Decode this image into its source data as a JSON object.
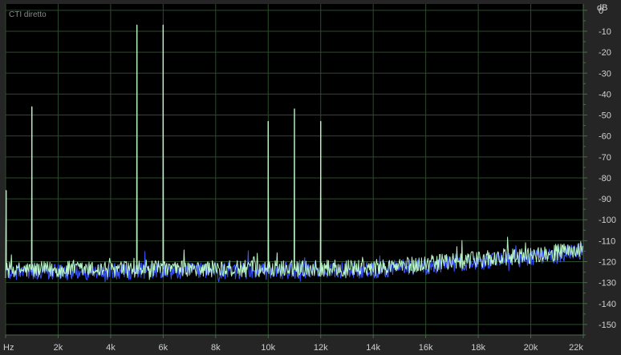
{
  "chart_data": {
    "type": "line",
    "title": "CTI diretto",
    "y_unit": "dB",
    "xlim": [
      0,
      22000
    ],
    "ylim": [
      -155,
      3
    ],
    "x_ticks": [
      {
        "v": 0,
        "label": "Hz"
      },
      {
        "v": 2000,
        "label": "2k"
      },
      {
        "v": 4000,
        "label": "4k"
      },
      {
        "v": 6000,
        "label": "6k"
      },
      {
        "v": 8000,
        "label": "8k"
      },
      {
        "v": 10000,
        "label": "10k"
      },
      {
        "v": 12000,
        "label": "12k"
      },
      {
        "v": 14000,
        "label": "14k"
      },
      {
        "v": 16000,
        "label": "16k"
      },
      {
        "v": 18000,
        "label": "18k"
      },
      {
        "v": 20000,
        "label": "20k"
      },
      {
        "v": 22000,
        "label": "22k"
      }
    ],
    "y_ticks": [
      {
        "v": 0,
        "label": "0"
      },
      {
        "v": -10,
        "label": "-10"
      },
      {
        "v": -20,
        "label": "-20"
      },
      {
        "v": -30,
        "label": "-30"
      },
      {
        "v": -40,
        "label": "-40"
      },
      {
        "v": -50,
        "label": "-50"
      },
      {
        "v": -60,
        "label": "-60"
      },
      {
        "v": -70,
        "label": "-70"
      },
      {
        "v": -80,
        "label": "-80"
      },
      {
        "v": -90,
        "label": "-90"
      },
      {
        "v": -100,
        "label": "-100"
      },
      {
        "v": -110,
        "label": "-110"
      },
      {
        "v": -120,
        "label": "-120"
      },
      {
        "v": -130,
        "label": "-130"
      },
      {
        "v": -140,
        "label": "-140"
      },
      {
        "v": -150,
        "label": "-150"
      }
    ],
    "grid": true,
    "series": [
      {
        "color": "#b8f5c4",
        "noise_floor_db": [
          [
            0,
            -124
          ],
          [
            14000,
            -123
          ],
          [
            17000,
            -120
          ],
          [
            20000,
            -117
          ],
          [
            22000,
            -114
          ]
        ],
        "peaks": [
          {
            "x": 20,
            "y": -86
          },
          {
            "x": 1000,
            "y": -46
          },
          {
            "x": 5000,
            "y": -7
          },
          {
            "x": 6000,
            "y": -7
          },
          {
            "x": 10000,
            "y": -53
          },
          {
            "x": 11000,
            "y": -47
          },
          {
            "x": 12000,
            "y": -53
          }
        ]
      },
      {
        "color": "#3a55ff",
        "noise_floor_db": [
          [
            0,
            -125
          ],
          [
            14000,
            -124
          ],
          [
            17000,
            -121
          ],
          [
            20000,
            -118
          ],
          [
            22000,
            -115
          ]
        ],
        "peaks": []
      }
    ]
  },
  "colors": {
    "plot_background": "#000000",
    "frame_background": "#252525",
    "grid": "#2c4a2c",
    "grid_strong": "#4a6a4a",
    "tick_text": "#cfcfcf"
  }
}
